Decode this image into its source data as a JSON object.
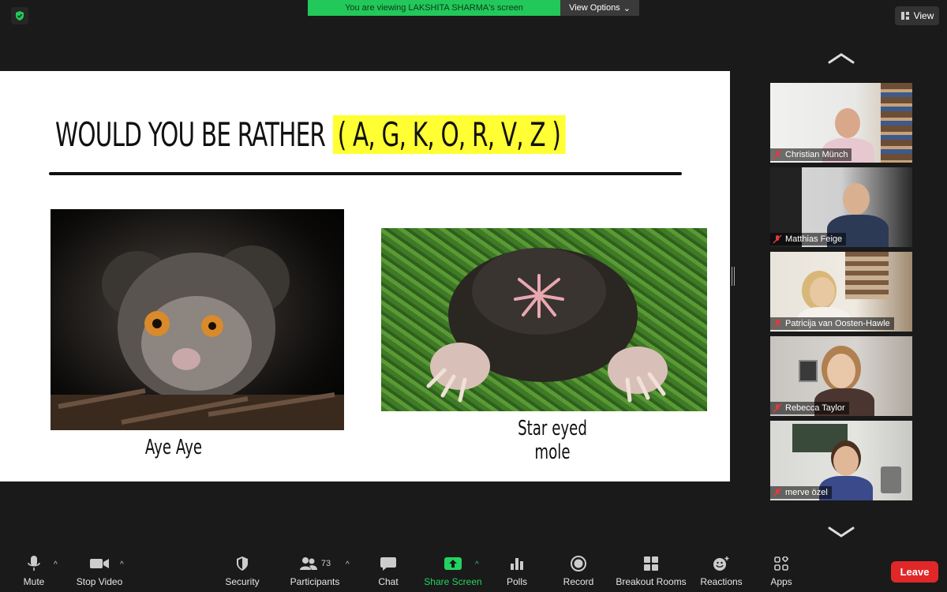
{
  "banner": {
    "text": "You are viewing LAKSHITA SHARMA's screen",
    "view_options": "View Options"
  },
  "view_button": "View",
  "slide": {
    "title": "WOULD YOU BE RATHER",
    "highlight": "( A, G, K, O, R, V, Z )",
    "caption_left": "Aye Aye",
    "caption_right": "Star eyed mole"
  },
  "participants_gallery": [
    {
      "name": "Christian Münch"
    },
    {
      "name": "Matthias Feige"
    },
    {
      "name": "Patricija van Oosten-Hawle"
    },
    {
      "name": "Rebecca Taylor"
    },
    {
      "name": "merve özel"
    }
  ],
  "toolbar": {
    "mute": "Mute",
    "stop_video": "Stop Video",
    "security": "Security",
    "participants": "Participants",
    "participants_count": "73",
    "chat": "Chat",
    "share_screen": "Share Screen",
    "polls": "Polls",
    "record": "Record",
    "breakout_rooms": "Breakout Rooms",
    "reactions": "Reactions",
    "apps": "Apps",
    "leave": "Leave"
  },
  "colors": {
    "banner_green": "#23c85a",
    "share_green": "#23d35f",
    "leave_red": "#e02828",
    "highlight_yellow": "#ffff33"
  }
}
